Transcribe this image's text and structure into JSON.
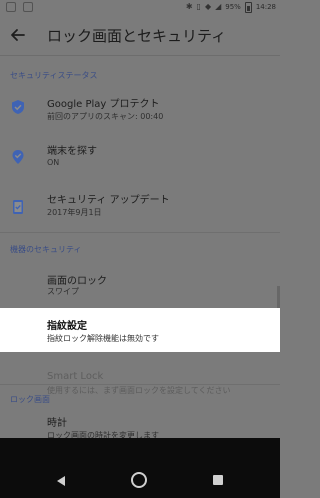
{
  "status_bar": {
    "battery": "95%",
    "time": "14:28"
  },
  "header": {
    "title": "ロック画面とセキュリティ"
  },
  "sections": {
    "security_status": "セキュリティステータス",
    "device_security": "機器のセキュリティ",
    "lock_screen": "ロック画面"
  },
  "items": {
    "play_protect": {
      "title": "Google Play プロテクト",
      "sub": "前回のアプリのスキャン: 00:40"
    },
    "find_device": {
      "title": "端末を探す",
      "sub": "ON"
    },
    "security_update": {
      "title": "セキュリティ アップデート",
      "sub": "2017年9月1日"
    },
    "screen_lock": {
      "title": "画面のロック",
      "sub": "スワイプ"
    },
    "fingerprint": {
      "title": "指紋設定",
      "sub": "指紋ロック解除機能は無効です"
    },
    "smart_lock": {
      "title": "Smart Lock",
      "sub": "使用するには、まず画面ロックを設定してください"
    },
    "clock": {
      "title": "時計",
      "sub": "ロック画面の時計を変更します"
    }
  },
  "colors": {
    "accent": "#3a4d86",
    "icon_blue": "#3f63b4",
    "highlight": "#ffffff",
    "dim_bg": "#7b7b7b",
    "nav_bg": "#0c0c0c"
  },
  "icons": {
    "back": "arrow-left-icon",
    "play_protect": "shield-check-icon",
    "find_device": "location-check-icon",
    "security_update": "phone-update-icon",
    "nav_back": "triangle-back-icon",
    "nav_home": "circle-home-icon",
    "nav_recents": "square-recents-icon"
  }
}
